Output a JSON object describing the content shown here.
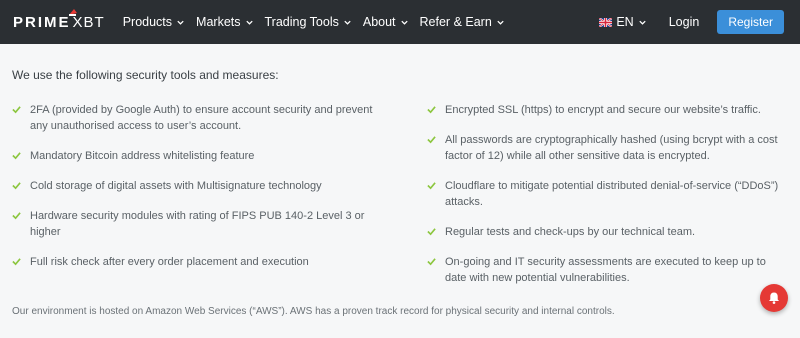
{
  "brand": {
    "prime": "PRIME",
    "xbt": "XBT"
  },
  "nav": [
    {
      "label": "Products"
    },
    {
      "label": "Markets"
    },
    {
      "label": "Trading Tools"
    },
    {
      "label": "About"
    },
    {
      "label": "Refer & Earn"
    }
  ],
  "header_right": {
    "language": "EN",
    "login": "Login",
    "register": "Register"
  },
  "heading": "We use the following security tools and measures:",
  "left_items": [
    "2FA (provided by Google Auth) to ensure account security and prevent any unauthorised access to user’s account.",
    "Mandatory Bitcoin address whitelisting feature",
    "Cold storage of digital assets with Multisignature technology",
    "Hardware security modules with rating of FIPS PUB 140-2 Level 3 or higher",
    "Full risk check after every order placement and execution"
  ],
  "right_items": [
    "Encrypted SSL (https) to encrypt and secure our website’s traffic.",
    "All passwords are cryptographically hashed (using bcrypt with a cost factor of 12) while all other sensitive data is encrypted.",
    "Cloudflare to mitigate potential distributed denial-of-service (“DDoS”) attacks.",
    "Regular tests and check-ups by our technical team.",
    "On-going and IT security assessments are executed to keep up to date with new potential vulnerabilities."
  ],
  "footer_note": "Our environment is hosted on Amazon Web Services (“AWS”). AWS has a proven track record for physical security and internal controls.",
  "colors": {
    "accent": "#3b8fd9",
    "check": "#8cc63f",
    "navbar": "#2b2f33",
    "notification": "#e53935"
  },
  "icons": {
    "check": "check-icon",
    "chevron": "chevron-down-icon",
    "flag": "uk-flag-icon",
    "bell": "bell-icon"
  }
}
